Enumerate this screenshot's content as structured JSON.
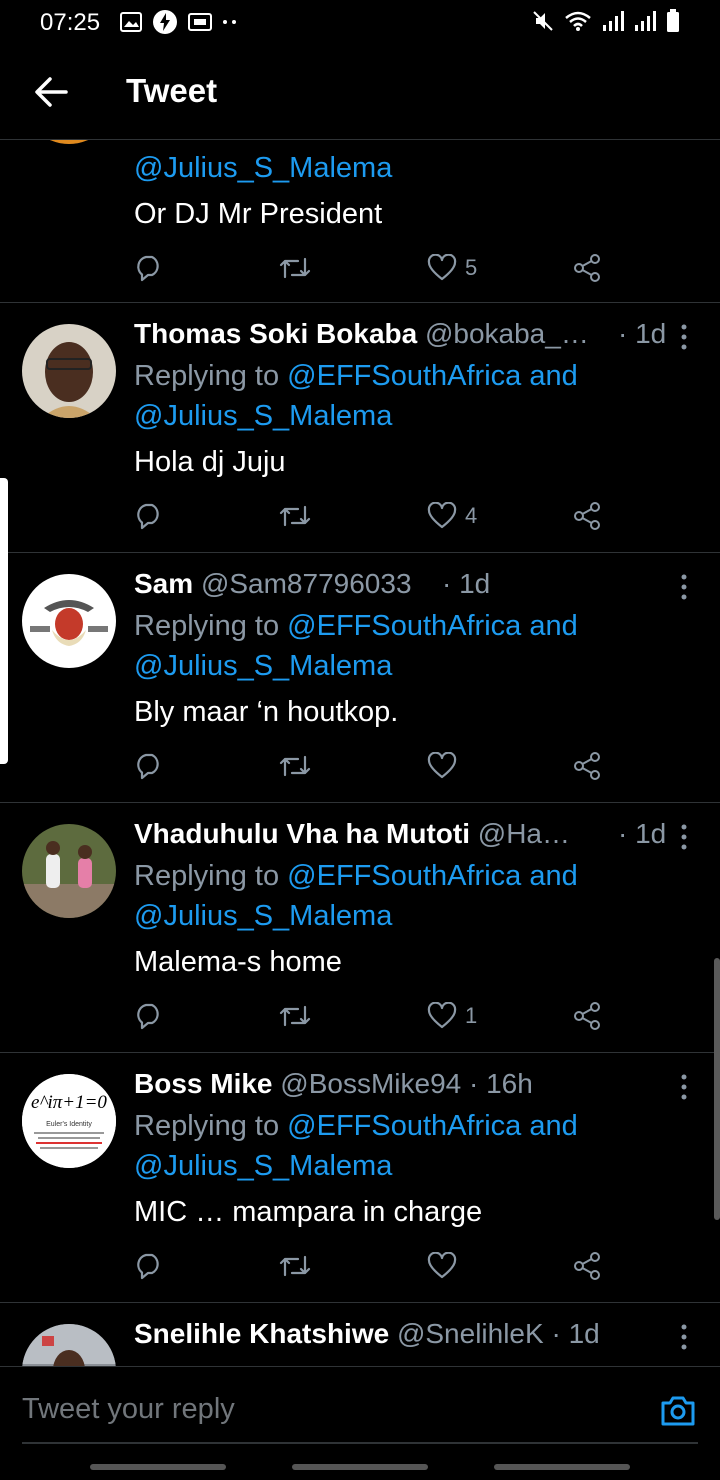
{
  "status_bar": {
    "time": "07:25"
  },
  "header": {
    "title": "Tweet"
  },
  "partial_tweet": {
    "reply_to_2": "@Julius_S_Malema",
    "text": "Or DJ Mr President",
    "likes": "5"
  },
  "tweets": [
    {
      "name": "Thomas Soki Bokaba",
      "handle": "@bokaba_…",
      "time": "· 1d",
      "replying_prefix": "Replying to ",
      "reply_to_1": "@EFFSouthAfrica and",
      "reply_to_2": "@Julius_S_Malema",
      "text": "Hola dj Juju",
      "likes": "4"
    },
    {
      "name": "Sam",
      "handle": "@Sam87796033",
      "time": "· 1d",
      "replying_prefix": "Replying to ",
      "reply_to_1": "@EFFSouthAfrica and",
      "reply_to_2": "@Julius_S_Malema",
      "text": "Bly maar ‘n houtkop.",
      "likes": ""
    },
    {
      "name": "Vhaduhulu Vha ha Mutoti",
      "handle": "@Ha…",
      "time": "· 1d",
      "replying_prefix": "Replying to ",
      "reply_to_1": "@EFFSouthAfrica and",
      "reply_to_2": "@Julius_S_Malema",
      "text": "Malema-s home",
      "likes": "1"
    },
    {
      "name": "Boss Mike",
      "handle": "@BossMike94",
      "time": "· 16h",
      "replying_prefix": "Replying to ",
      "reply_to_1": "@EFFSouthAfrica and",
      "reply_to_2": "@Julius_S_Malema",
      "text": "MIC … mampara in charge",
      "likes": ""
    },
    {
      "name": "Snelihle Khatshiwe",
      "handle": "@SnelihleK",
      "time": "· 1d"
    }
  ],
  "boss_mike_avatar": {
    "formula": "e^iπ+1=0",
    "caption": "Euler's Identity"
  },
  "compose": {
    "placeholder": "Tweet your reply"
  },
  "icons": {
    "back": "arrow-left-icon",
    "reply": "reply-icon",
    "retweet": "retweet-icon",
    "like": "heart-icon",
    "share": "share-icon",
    "more": "more-vertical-icon",
    "camera": "camera-icon"
  },
  "colors": {
    "accent": "#1d9bf0",
    "background": "#000000",
    "muted": "#8b98a5"
  }
}
